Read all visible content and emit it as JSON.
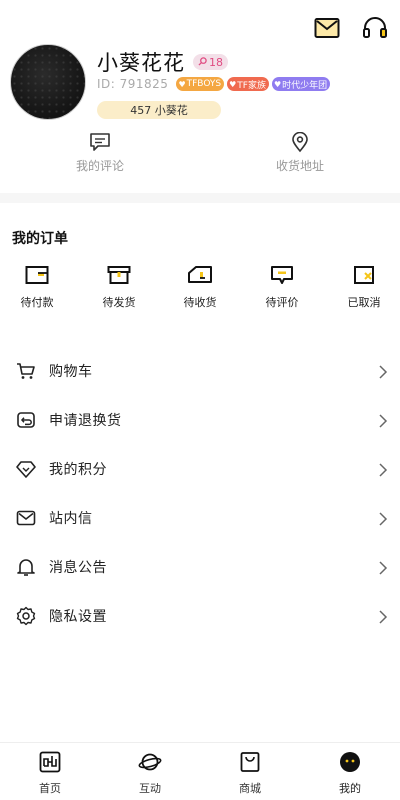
{
  "profile": {
    "username": "小葵花花",
    "level": "18",
    "user_id": "ID: 791825",
    "tags": [
      "TFBOYS",
      "TF家族",
      "时代少年团"
    ],
    "fans_label": "457 小葵花"
  },
  "quick_links": {
    "comments": "我的评论",
    "address": "收货地址"
  },
  "orders": {
    "title": "我的订单",
    "items": [
      "待付款",
      "待发货",
      "待收货",
      "待评价",
      "已取消"
    ]
  },
  "menu": [
    "购物车",
    "申请退换货",
    "我的积分",
    "站内信",
    "消息公告",
    "隐私设置"
  ],
  "tabbar": [
    "首页",
    "互动",
    "商城",
    "我的"
  ],
  "colors": {
    "accent": "#F5C518",
    "level_badge": "#E04C82",
    "tag_orange": "#F4A742",
    "tag_red": "#F06A4F",
    "tag_purple": "#8F7CF0",
    "fans_bg": "#FBEDC9"
  },
  "icons": {
    "top": [
      "mail-icon",
      "headset-icon"
    ],
    "menu": [
      "cart-icon",
      "return-icon",
      "diamond-icon",
      "mail-icon",
      "bell-icon",
      "gear-icon"
    ]
  }
}
